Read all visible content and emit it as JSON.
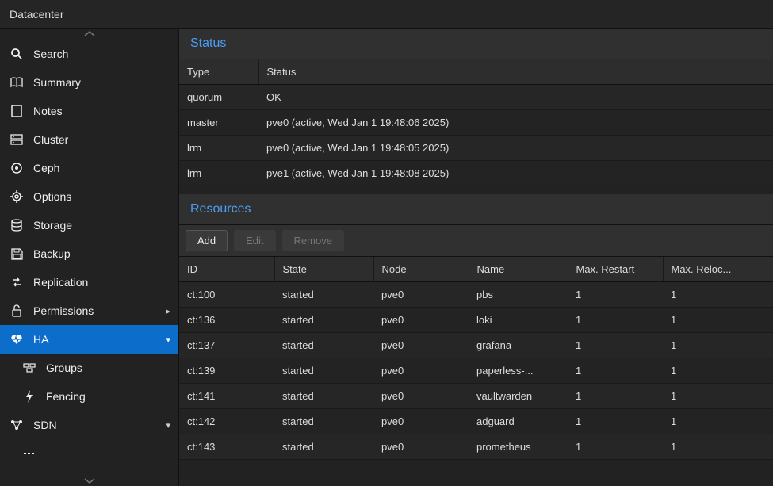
{
  "topbar": {
    "title": "Datacenter"
  },
  "sidebar": {
    "items": [
      {
        "label": "Search",
        "icon": "search"
      },
      {
        "label": "Summary",
        "icon": "book"
      },
      {
        "label": "Notes",
        "icon": "note"
      },
      {
        "label": "Cluster",
        "icon": "cluster"
      },
      {
        "label": "Ceph",
        "icon": "ceph"
      },
      {
        "label": "Options",
        "icon": "gear"
      },
      {
        "label": "Storage",
        "icon": "db"
      },
      {
        "label": "Backup",
        "icon": "save"
      },
      {
        "label": "Replication",
        "icon": "repl"
      },
      {
        "label": "Permissions",
        "icon": "lock"
      },
      {
        "label": "HA",
        "icon": "heart"
      },
      {
        "label": "Groups",
        "icon": "groups"
      },
      {
        "label": "Fencing",
        "icon": "bolt"
      },
      {
        "label": "SDN",
        "icon": "sdn"
      }
    ]
  },
  "status": {
    "title": "Status",
    "headers": [
      "Type",
      "Status"
    ],
    "rows": [
      {
        "type": "quorum",
        "status": "OK"
      },
      {
        "type": "master",
        "status": "pve0 (active, Wed Jan 1 19:48:06 2025)"
      },
      {
        "type": "lrm",
        "status": "pve0 (active, Wed Jan 1 19:48:05 2025)"
      },
      {
        "type": "lrm",
        "status": "pve1 (active, Wed Jan 1 19:48:08 2025)"
      }
    ]
  },
  "resources": {
    "title": "Resources",
    "buttons": {
      "add": "Add",
      "edit": "Edit",
      "remove": "Remove"
    },
    "headers": [
      "ID",
      "State",
      "Node",
      "Name",
      "Max. Restart",
      "Max. Reloc..."
    ],
    "rows": [
      {
        "id": "ct:100",
        "state": "started",
        "node": "pve0",
        "name": "pbs",
        "restart": "1",
        "reloc": "1"
      },
      {
        "id": "ct:136",
        "state": "started",
        "node": "pve0",
        "name": "loki",
        "restart": "1",
        "reloc": "1"
      },
      {
        "id": "ct:137",
        "state": "started",
        "node": "pve0",
        "name": "grafana",
        "restart": "1",
        "reloc": "1"
      },
      {
        "id": "ct:139",
        "state": "started",
        "node": "pve0",
        "name": "paperless-...",
        "restart": "1",
        "reloc": "1"
      },
      {
        "id": "ct:141",
        "state": "started",
        "node": "pve0",
        "name": "vaultwarden",
        "restart": "1",
        "reloc": "1"
      },
      {
        "id": "ct:142",
        "state": "started",
        "node": "pve0",
        "name": "adguard",
        "restart": "1",
        "reloc": "1"
      },
      {
        "id": "ct:143",
        "state": "started",
        "node": "pve0",
        "name": "prometheus",
        "restart": "1",
        "reloc": "1"
      }
    ]
  }
}
